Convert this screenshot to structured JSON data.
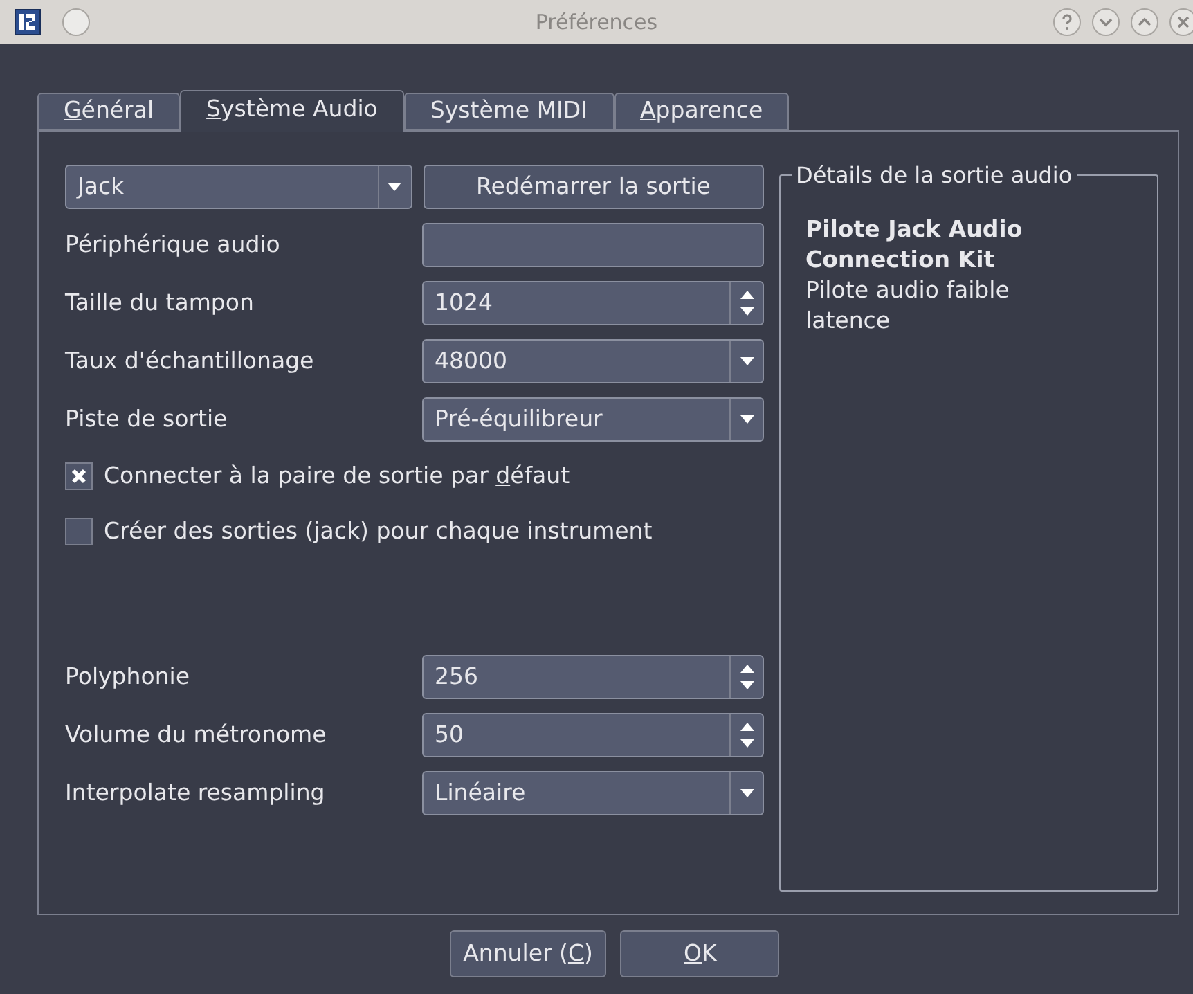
{
  "window": {
    "title": "Préférences"
  },
  "tabs": [
    {
      "key": "G",
      "post": "énéral",
      "selected": false
    },
    {
      "key": "S",
      "post": "ystème Audio",
      "selected": true
    },
    {
      "pre": "Système MIDI",
      "selected": false
    },
    {
      "key": "A",
      "post": "pparence",
      "selected": false
    }
  ],
  "driver": {
    "value": "Jack"
  },
  "restart_button": "Redémarrer la sortie",
  "settings": [
    {
      "label": "Périphérique audio",
      "kind": "field"
    },
    {
      "label": "Taille du tampon",
      "kind": "spin",
      "value": "1024"
    },
    {
      "label": "Taux d'échantillonage",
      "kind": "combo",
      "value": "48000"
    },
    {
      "label": "Piste de sortie",
      "kind": "combo",
      "value": "Pré-équilibreur"
    }
  ],
  "checkboxes": [
    {
      "pre": "Connecter à la paire de sortie par ",
      "key": "d",
      "post": "éfaut",
      "checked": true
    },
    {
      "pre": "Créer des sorties (jack) pour chaque instrument",
      "checked": false
    }
  ],
  "settings_2": [
    {
      "label": "Polyphonie",
      "kind": "spin",
      "value": "256"
    },
    {
      "label": "Volume du métronome",
      "kind": "spin",
      "value": "50"
    },
    {
      "label": "Interpolate resampling",
      "kind": "combo",
      "value": "Linéaire"
    }
  ],
  "details": {
    "title": "Détails de la sortie audio",
    "name": "Pilote Jack Audio Connection Kit",
    "description": "Pilote audio faible latence"
  },
  "buttons": [
    {
      "pre": "Annuler (",
      "key": "C",
      "post": ")"
    },
    {
      "key": "O",
      "post": "K"
    }
  ]
}
